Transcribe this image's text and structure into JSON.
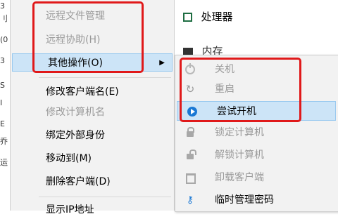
{
  "background": {
    "left_strip": [
      "3",
      "刂",
      "(0",
      "3",
      "S",
      "I",
      "E",
      "乔",
      "运"
    ],
    "processor_label": "处理器",
    "memory_label": "内存"
  },
  "context_menu": {
    "items": [
      {
        "label": "远程文件管理",
        "enabled": false
      },
      {
        "label": "远程协助(H)",
        "enabled": false
      },
      {
        "label": "其他操作(O)",
        "enabled": true,
        "highlighted": true,
        "submenu_arrow": "▶"
      },
      {
        "label": "修改客户端名(E)",
        "enabled": true
      },
      {
        "label": "修改计算机名",
        "enabled": false
      },
      {
        "label": "绑定外部身份",
        "enabled": true
      },
      {
        "label": "移动到(M)",
        "enabled": true
      },
      {
        "label": "删除客户端(D)",
        "enabled": true
      },
      {
        "label": "显示IP地址",
        "enabled": true
      }
    ]
  },
  "submenu": {
    "items": [
      {
        "label": "关机",
        "icon": "power-icon",
        "enabled": false
      },
      {
        "label": "重启",
        "icon": "restart-icon",
        "enabled": false
      },
      {
        "label": "尝试开机",
        "icon": "play-icon",
        "enabled": true,
        "highlighted": true
      },
      {
        "label": "锁定计算机",
        "icon": "lock-icon",
        "enabled": false
      },
      {
        "label": "解锁计算机",
        "icon": "unlock-icon",
        "enabled": false
      },
      {
        "label": "卸载客户端",
        "icon": "trash-icon",
        "enabled": false
      },
      {
        "label": "临时管理密码",
        "icon": "key-icon",
        "enabled": true
      }
    ]
  },
  "colors": {
    "annotation_red": "#e0191a",
    "highlight_bg": "#cce4f7",
    "highlight_border": "#99c9ef",
    "disabled_text": "#9a9a9a",
    "accent_blue": "#1a78d4"
  }
}
